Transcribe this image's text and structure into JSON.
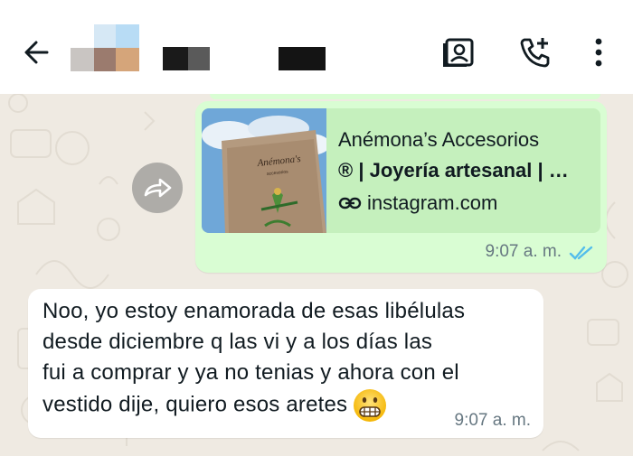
{
  "header": {
    "back_icon": "arrow-left-icon",
    "contact_name_redacted": true,
    "actions": [
      {
        "icon": "contact-card-icon"
      },
      {
        "icon": "add-call-icon"
      },
      {
        "icon": "more-vertical-icon"
      }
    ]
  },
  "colors": {
    "chat_bg": "#efeae2",
    "outgoing_bubble": "#d9fdd3",
    "incoming_bubble": "#ffffff",
    "read_ticks": "#53bdeb",
    "meta_text": "#667781"
  },
  "messages": [
    {
      "direction": "outgoing",
      "link_preview": {
        "title_line1": "Anémona’s Accesorios",
        "title_line2": "® | Joyería artesanal | …",
        "domain": "instagram.com",
        "domain_icon": "link-icon"
      },
      "time": "9:07 a. m.",
      "status": "read",
      "forward_icon": "forward-icon"
    },
    {
      "direction": "incoming",
      "lines": [
        "Noo, yo estoy enamorada de esas libélulas",
        "desde diciembre q las vi y a los días las",
        "fui a comprar y ya no tenias y ahora con el",
        "vestido dije, quiero esos aretes"
      ],
      "emoji": "grimacing-face-emoji",
      "time": "9:07 a. m."
    }
  ]
}
